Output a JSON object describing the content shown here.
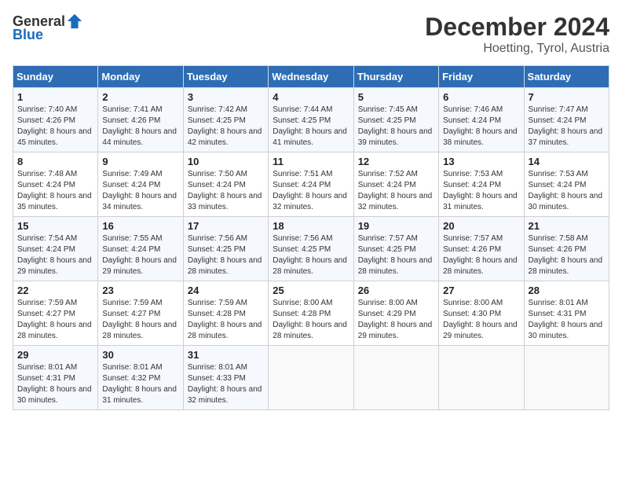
{
  "header": {
    "logo_general": "General",
    "logo_blue": "Blue",
    "title": "December 2024",
    "subtitle": "Hoetting, Tyrol, Austria"
  },
  "days_of_week": [
    "Sunday",
    "Monday",
    "Tuesday",
    "Wednesday",
    "Thursday",
    "Friday",
    "Saturday"
  ],
  "weeks": [
    [
      {
        "day": "1",
        "sunrise": "7:40 AM",
        "sunset": "4:26 PM",
        "daylight": "8 hours and 45 minutes."
      },
      {
        "day": "2",
        "sunrise": "7:41 AM",
        "sunset": "4:26 PM",
        "daylight": "8 hours and 44 minutes."
      },
      {
        "day": "3",
        "sunrise": "7:42 AM",
        "sunset": "4:25 PM",
        "daylight": "8 hours and 42 minutes."
      },
      {
        "day": "4",
        "sunrise": "7:44 AM",
        "sunset": "4:25 PM",
        "daylight": "8 hours and 41 minutes."
      },
      {
        "day": "5",
        "sunrise": "7:45 AM",
        "sunset": "4:25 PM",
        "daylight": "8 hours and 39 minutes."
      },
      {
        "day": "6",
        "sunrise": "7:46 AM",
        "sunset": "4:24 PM",
        "daylight": "8 hours and 38 minutes."
      },
      {
        "day": "7",
        "sunrise": "7:47 AM",
        "sunset": "4:24 PM",
        "daylight": "8 hours and 37 minutes."
      }
    ],
    [
      {
        "day": "8",
        "sunrise": "7:48 AM",
        "sunset": "4:24 PM",
        "daylight": "8 hours and 35 minutes."
      },
      {
        "day": "9",
        "sunrise": "7:49 AM",
        "sunset": "4:24 PM",
        "daylight": "8 hours and 34 minutes."
      },
      {
        "day": "10",
        "sunrise": "7:50 AM",
        "sunset": "4:24 PM",
        "daylight": "8 hours and 33 minutes."
      },
      {
        "day": "11",
        "sunrise": "7:51 AM",
        "sunset": "4:24 PM",
        "daylight": "8 hours and 32 minutes."
      },
      {
        "day": "12",
        "sunrise": "7:52 AM",
        "sunset": "4:24 PM",
        "daylight": "8 hours and 32 minutes."
      },
      {
        "day": "13",
        "sunrise": "7:53 AM",
        "sunset": "4:24 PM",
        "daylight": "8 hours and 31 minutes."
      },
      {
        "day": "14",
        "sunrise": "7:53 AM",
        "sunset": "4:24 PM",
        "daylight": "8 hours and 30 minutes."
      }
    ],
    [
      {
        "day": "15",
        "sunrise": "7:54 AM",
        "sunset": "4:24 PM",
        "daylight": "8 hours and 29 minutes."
      },
      {
        "day": "16",
        "sunrise": "7:55 AM",
        "sunset": "4:24 PM",
        "daylight": "8 hours and 29 minutes."
      },
      {
        "day": "17",
        "sunrise": "7:56 AM",
        "sunset": "4:25 PM",
        "daylight": "8 hours and 28 minutes."
      },
      {
        "day": "18",
        "sunrise": "7:56 AM",
        "sunset": "4:25 PM",
        "daylight": "8 hours and 28 minutes."
      },
      {
        "day": "19",
        "sunrise": "7:57 AM",
        "sunset": "4:25 PM",
        "daylight": "8 hours and 28 minutes."
      },
      {
        "day": "20",
        "sunrise": "7:57 AM",
        "sunset": "4:26 PM",
        "daylight": "8 hours and 28 minutes."
      },
      {
        "day": "21",
        "sunrise": "7:58 AM",
        "sunset": "4:26 PM",
        "daylight": "8 hours and 28 minutes."
      }
    ],
    [
      {
        "day": "22",
        "sunrise": "7:59 AM",
        "sunset": "4:27 PM",
        "daylight": "8 hours and 28 minutes."
      },
      {
        "day": "23",
        "sunrise": "7:59 AM",
        "sunset": "4:27 PM",
        "daylight": "8 hours and 28 minutes."
      },
      {
        "day": "24",
        "sunrise": "7:59 AM",
        "sunset": "4:28 PM",
        "daylight": "8 hours and 28 minutes."
      },
      {
        "day": "25",
        "sunrise": "8:00 AM",
        "sunset": "4:28 PM",
        "daylight": "8 hours and 28 minutes."
      },
      {
        "day": "26",
        "sunrise": "8:00 AM",
        "sunset": "4:29 PM",
        "daylight": "8 hours and 29 minutes."
      },
      {
        "day": "27",
        "sunrise": "8:00 AM",
        "sunset": "4:30 PM",
        "daylight": "8 hours and 29 minutes."
      },
      {
        "day": "28",
        "sunrise": "8:01 AM",
        "sunset": "4:31 PM",
        "daylight": "8 hours and 30 minutes."
      }
    ],
    [
      {
        "day": "29",
        "sunrise": "8:01 AM",
        "sunset": "4:31 PM",
        "daylight": "8 hours and 30 minutes."
      },
      {
        "day": "30",
        "sunrise": "8:01 AM",
        "sunset": "4:32 PM",
        "daylight": "8 hours and 31 minutes."
      },
      {
        "day": "31",
        "sunrise": "8:01 AM",
        "sunset": "4:33 PM",
        "daylight": "8 hours and 32 minutes."
      },
      null,
      null,
      null,
      null
    ]
  ]
}
